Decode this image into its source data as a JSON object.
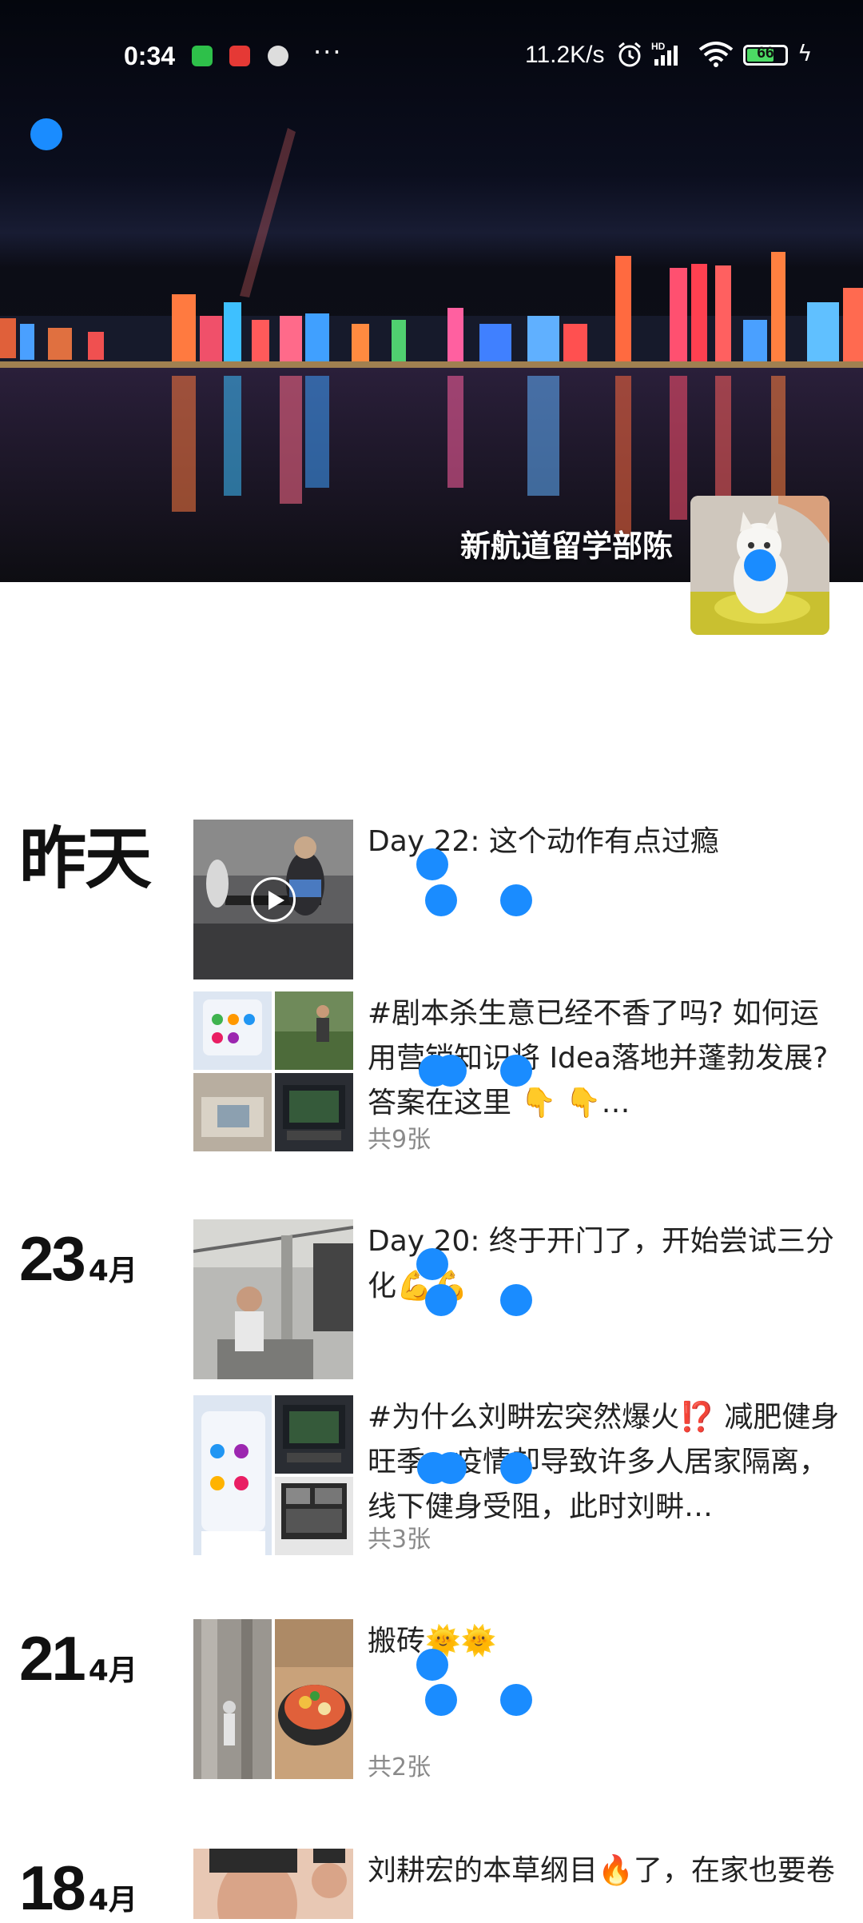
{
  "status_bar": {
    "time": "0:34",
    "more": "···",
    "net_speed": "11.2K/s",
    "hd_label": "HD",
    "battery": "66"
  },
  "cover": {
    "owner_name": "新航道留学部陈"
  },
  "feed": [
    {
      "date_label": "昨天",
      "posts": [
        {
          "text": "Day 22: 这个动作有点过瘾",
          "type": "video"
        },
        {
          "text": "#剧本杀生意已经不香了吗? 如何运用营销知识将 Idea落地并蓬勃发展? 答案在这里 👇 👇…",
          "count": "共9张"
        }
      ]
    },
    {
      "day": "23",
      "month": "4月",
      "posts": [
        {
          "text": "Day 20: 终于开门了，开始尝试三分化💪💪"
        },
        {
          "text": "#为什么刘畊宏突然爆火⁉️ 减肥健身旺季，疫情却导致许多人居家隔离，线下健身受阻，此时刘畊…",
          "count": "共3张"
        }
      ]
    },
    {
      "day": "21",
      "month": "4月",
      "posts": [
        {
          "text": "搬砖🌞🌞",
          "count": "共2张"
        }
      ]
    },
    {
      "day": "18",
      "month": "4月",
      "posts": [
        {
          "text": "刘耕宏的本草纲目🔥了，在家也要卷"
        }
      ]
    }
  ],
  "colors": {
    "accent_dot": "#1a8cff",
    "count_text": "#8a8a8a"
  },
  "icons": [
    "back-icon",
    "wechat-icon",
    "app-icon",
    "alarm-icon",
    "signal-icon",
    "wifi-icon",
    "battery-icon",
    "charging-icon",
    "play-icon"
  ]
}
